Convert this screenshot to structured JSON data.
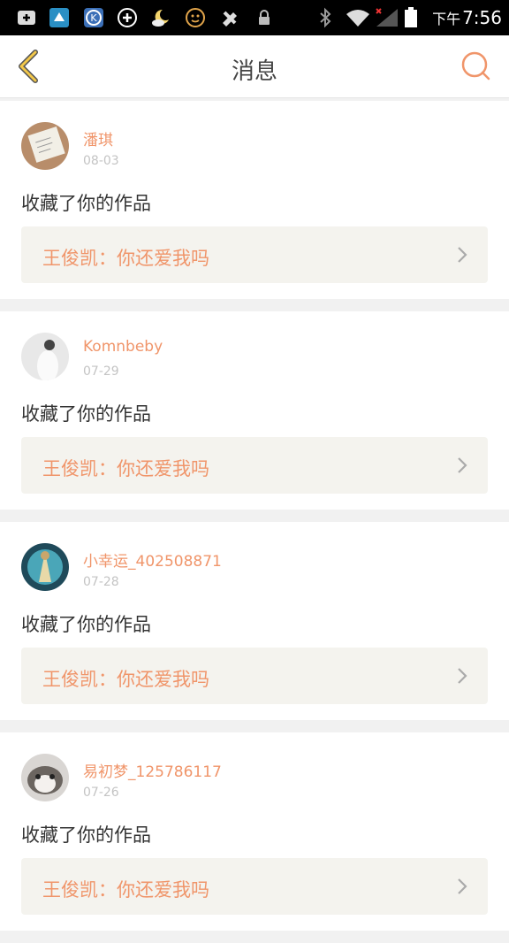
{
  "status_bar": {
    "time_prefix": "下午",
    "time": "7:56",
    "icons": [
      "add-icon",
      "app-icon",
      "k-app-icon",
      "plus-circle-icon",
      "cloud-moon-icon",
      "smiley-icon",
      "tools-icon",
      "lock-icon",
      "bluetooth-icon",
      "wifi-icon",
      "signal-icon",
      "battery-icon"
    ]
  },
  "header": {
    "title": "消息",
    "back_icon": "chevron-left-icon",
    "search_icon": "search-icon"
  },
  "colors": {
    "accent": "#f0956a",
    "back_icon": "#f3c84a",
    "work_box_bg": "#f4f3ee"
  },
  "messages": [
    {
      "username": "潘琪",
      "date": "08-03",
      "action": "收藏了你的作品",
      "work": "王俊凯：你还爱我吗"
    },
    {
      "username": "Komnbeby",
      "date": "07-29",
      "action": "收藏了你的作品",
      "work": "王俊凯：你还爱我吗"
    },
    {
      "username": "小幸运_402508871",
      "date": "07-28",
      "action": "收藏了你的作品",
      "work": "王俊凯：你还爱我吗"
    },
    {
      "username": "易初梦_125786117",
      "date": "07-26",
      "action": "收藏了你的作品",
      "work": "王俊凯：你还爱我吗"
    }
  ]
}
